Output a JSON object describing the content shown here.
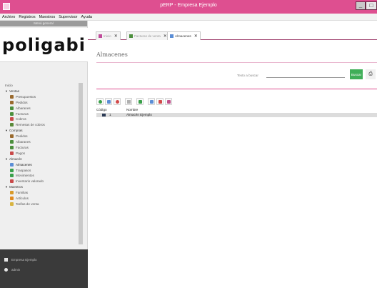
{
  "window": {
    "title": "pERP - Empresa Ejemplo",
    "min_label": "_",
    "max_label": "□"
  },
  "menu": [
    "Archivo",
    "Registros",
    "Maestros",
    "Supervisor",
    "Ayuda"
  ],
  "sidebar": {
    "header": "Menú general",
    "logo": "poligabi",
    "tree": [
      {
        "label": "Inicio",
        "level": 0,
        "type": "leaf"
      },
      {
        "label": "Ventas",
        "level": 0,
        "type": "section"
      },
      {
        "label": "Presupuestos",
        "level": 1,
        "icon": "budget-icon",
        "color": "#9a6a2e"
      },
      {
        "label": "Pedidos",
        "level": 1,
        "icon": "order-icon",
        "color": "#9a6a2e"
      },
      {
        "label": "Albaranes",
        "level": 1,
        "icon": "delivery-note-icon",
        "color": "#4c8f3d"
      },
      {
        "label": "Facturas",
        "level": 1,
        "icon": "invoice-icon",
        "color": "#4c8f3d"
      },
      {
        "label": "Cobros",
        "level": 1,
        "icon": "collection-icon",
        "color": "#c94a4a"
      },
      {
        "label": "Remesas de cobros",
        "level": 1,
        "icon": "remittance-icon",
        "color": "#5a8a3a"
      },
      {
        "label": "Compras",
        "level": 0,
        "type": "section"
      },
      {
        "label": "Pedidos",
        "level": 1,
        "icon": "order-icon",
        "color": "#9a6a2e"
      },
      {
        "label": "Albaranes",
        "level": 1,
        "icon": "delivery-note-icon",
        "color": "#4c8f3d"
      },
      {
        "label": "Facturas",
        "level": 1,
        "icon": "invoice-icon",
        "color": "#4c8f3d"
      },
      {
        "label": "Pagos",
        "level": 1,
        "icon": "payment-icon",
        "color": "#c94a4a"
      },
      {
        "label": "Almacén",
        "level": 0,
        "type": "section"
      },
      {
        "label": "Almacenes",
        "level": 1,
        "icon": "warehouse-icon",
        "color": "#5b8ed6",
        "selected": true
      },
      {
        "label": "Traspasos",
        "level": 1,
        "icon": "transfer-icon",
        "color": "#3aa04a"
      },
      {
        "label": "Movimientos",
        "level": 1,
        "icon": "movements-icon",
        "color": "#3aa04a"
      },
      {
        "label": "Inventario valorado",
        "level": 1,
        "icon": "inventory-icon",
        "color": "#c94a4a"
      },
      {
        "label": "Maestros",
        "level": 0,
        "type": "section"
      },
      {
        "label": "Familias",
        "level": 1,
        "icon": "families-icon",
        "color": "#d89a2a"
      },
      {
        "label": "Artículos",
        "level": 1,
        "icon": "articles-icon",
        "color": "#e08a20"
      },
      {
        "label": "Tarifas de venta",
        "level": 1,
        "icon": "price-list-icon",
        "color": "#d8b440"
      }
    ],
    "user_panel": {
      "company": "Empresa Ejemplo",
      "user": "admin"
    }
  },
  "tabs": [
    {
      "label": "Inicio",
      "icon": "home-icon",
      "color": "#c04b9a",
      "active": false
    },
    {
      "label": "Facturas de venta",
      "icon": "invoice-icon",
      "color": "#4c8f3d",
      "active": false
    },
    {
      "label": "Almacenes",
      "icon": "warehouse-icon",
      "color": "#5b8ed6",
      "active": true
    }
  ],
  "page": {
    "title": "Almacenes",
    "search_label": "Texto a buscar",
    "search_value": "",
    "search_button": "Buscar",
    "print_icon": "printer-icon"
  },
  "toolbar": [
    {
      "name": "add-icon",
      "color": "#3aa04a"
    },
    {
      "name": "edit-icon",
      "color": "#5b8ed6"
    },
    {
      "name": "delete-icon",
      "color": "#d24a4a"
    },
    {
      "name": "list-icon",
      "color": "#b0b0b0"
    },
    {
      "name": "export-icon",
      "color": "#3aa04a"
    },
    {
      "name": "print-icon",
      "color": "#5b8ed6"
    },
    {
      "name": "report-icon",
      "color": "#d24a4a"
    },
    {
      "name": "chart-icon",
      "color": "#c0508a"
    }
  ],
  "grid": {
    "columns": [
      "Código",
      "Nombre"
    ],
    "rows": [
      {
        "code": "1",
        "name": "Almacén Ejemplo"
      }
    ]
  },
  "colors": {
    "accent": "#de4f90",
    "search_button": "#3fae58",
    "user_panel": "#3a3a3a"
  }
}
